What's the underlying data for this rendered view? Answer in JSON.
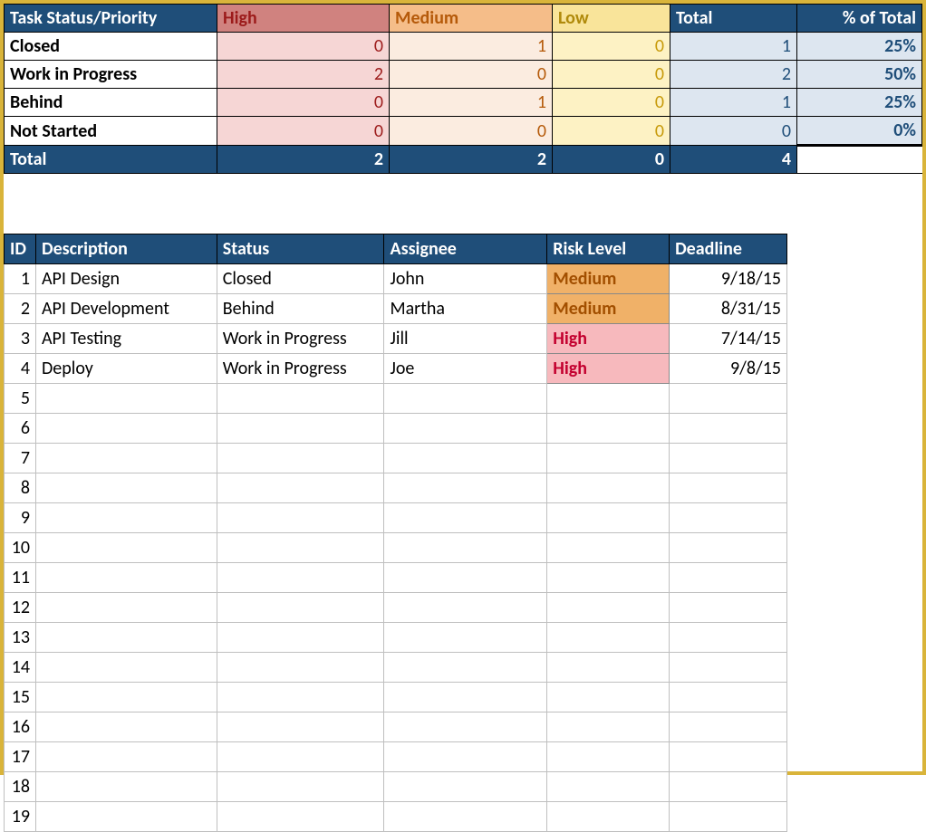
{
  "summary": {
    "header": {
      "title": "Task Status/Priority",
      "high": "High",
      "medium": "Medium",
      "low": "Low",
      "total": "Total",
      "pct": "% of Total"
    },
    "rows": [
      {
        "label": "Closed",
        "high": 0,
        "medium": 1,
        "low": 0,
        "total": 1,
        "pct": "25%"
      },
      {
        "label": "Work in Progress",
        "high": 2,
        "medium": 0,
        "low": 0,
        "total": 2,
        "pct": "50%"
      },
      {
        "label": "Behind",
        "high": 0,
        "medium": 1,
        "low": 0,
        "total": 1,
        "pct": "25%"
      },
      {
        "label": "Not Started",
        "high": 0,
        "medium": 0,
        "low": 0,
        "total": 0,
        "pct": "0%"
      }
    ],
    "totals": {
      "label": "Total",
      "high": 2,
      "medium": 2,
      "low": 0,
      "total": 4
    }
  },
  "tasks": {
    "header": {
      "id": "ID",
      "description": "Description",
      "status": "Status",
      "assignee": "Assignee",
      "risk": "Risk Level",
      "deadline": "Deadline"
    },
    "rows": [
      {
        "id": 1,
        "description": "API Design",
        "status": "Closed",
        "assignee": "John",
        "risk": "Medium",
        "deadline": "9/18/15"
      },
      {
        "id": 2,
        "description": "API Development",
        "status": "Behind",
        "assignee": "Martha",
        "risk": "Medium",
        "deadline": "8/31/15"
      },
      {
        "id": 3,
        "description": "API Testing",
        "status": "Work in Progress",
        "assignee": "Jill",
        "risk": "High",
        "deadline": "7/14/15"
      },
      {
        "id": 4,
        "description": "Deploy",
        "status": "Work in Progress",
        "assignee": "Joe",
        "risk": "High",
        "deadline": "9/8/15"
      },
      {
        "id": 5
      },
      {
        "id": 6
      },
      {
        "id": 7
      },
      {
        "id": 8
      },
      {
        "id": 9
      },
      {
        "id": 10
      },
      {
        "id": 11
      },
      {
        "id": 12
      },
      {
        "id": 13
      },
      {
        "id": 14
      },
      {
        "id": 15
      },
      {
        "id": 16
      },
      {
        "id": 17
      },
      {
        "id": 18
      },
      {
        "id": 19
      }
    ]
  }
}
